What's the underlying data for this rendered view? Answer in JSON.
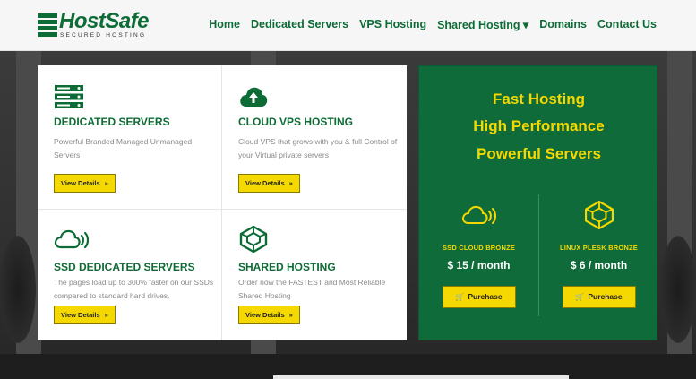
{
  "brand": {
    "name": "HostSafe",
    "tagline": "SECURED HOSTING",
    "color": "#0d6b36"
  },
  "nav": {
    "items": [
      {
        "label": "Home"
      },
      {
        "label": "Dedicated Servers"
      },
      {
        "label": "VPS Hosting"
      },
      {
        "label": "Shared Hosting ▾"
      },
      {
        "label": "Domains"
      },
      {
        "label": "Contact Us"
      }
    ]
  },
  "services": [
    {
      "title": "DEDICATED SERVERS",
      "description": "Powerful Branded Managed Unmanaged Servers",
      "button": "View Details",
      "icon": "server-icon"
    },
    {
      "title": "CLOUD VPS HOSTING",
      "description": "Cloud VPS that grows with you & full Control of your Virtual private servers",
      "button": "View Details",
      "icon": "cloud-upload-icon"
    },
    {
      "title": "SSD DEDICATED SERVERS",
      "description": "The pages load up to 300% faster on our SSDs compared to standard hard drives.",
      "button": "View Details",
      "icon": "cloud-signal-icon"
    },
    {
      "title": "SHARED HOSTING",
      "description": "Order now the FASTEST and Most Reliable Shared Hosting",
      "button": "View Details",
      "icon": "cube-icon"
    }
  ],
  "promo": {
    "lines": [
      "Fast Hosting",
      "High Performance",
      "Powerful Servers"
    ],
    "plans": [
      {
        "name": "SSD CLOUD BRONZE",
        "price": "$ 15 / month",
        "button": "Purchase",
        "icon": "cloud-signal-icon"
      },
      {
        "name": "LINUX PLESK BRONZE",
        "price": "$ 6 / month",
        "button": "Purchase",
        "icon": "cube-icon"
      }
    ],
    "accent": "#f5d800",
    "background": "#0f6b3a"
  },
  "icons": {
    "chevron": "»",
    "cart": "🛒"
  }
}
